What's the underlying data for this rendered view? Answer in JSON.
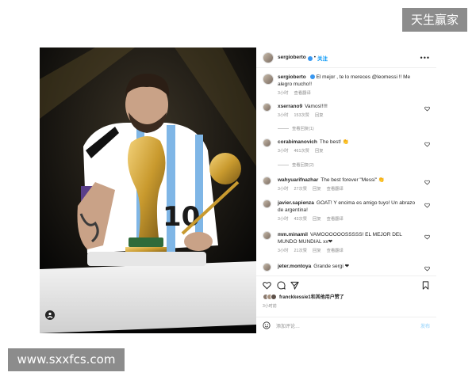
{
  "watermarks": {
    "top": "天生赢家",
    "bottom": "www.sxxfcs.com"
  },
  "photo": {
    "jersey_number": "10",
    "badge_icon": "info-icon"
  },
  "header": {
    "username": "sergioberto",
    "separator": "•",
    "follow_label": "关注",
    "more_icon": "more-horizontal-icon"
  },
  "caption": {
    "user": "sergioberto",
    "text": "El mejor , te lo mereces @leomessi !! Me alegro mucho!!",
    "time": "3小时",
    "translate": "查看翻译"
  },
  "comments": [
    {
      "user": "xserrano9",
      "text": "Vamos!!!!!",
      "time": "3小时",
      "likes": "153次赞",
      "reply": "回复",
      "replies": "查看回复(1)"
    },
    {
      "user": "corabimanovich",
      "text": "The best! 👏",
      "time": "3小时",
      "likes": "461次赞",
      "reply": "回复",
      "replies": "查看回复(2)"
    },
    {
      "user": "wahyuarifnazhar",
      "text": "The best forever \"Messi\" 👏",
      "time": "3小时",
      "likes": "27次赞",
      "reply": "回复",
      "translate": "查看翻译"
    },
    {
      "user": "javier.sapienza",
      "text": "GOAT! Y encima es amigo tuyo! Un abrazo de argentina!",
      "time": "3小时",
      "likes": "43次赞",
      "reply": "回复",
      "translate": "查看翻译"
    },
    {
      "user": "mm.minamil",
      "text": "VAMOOOOOOSSSSS! EL MEJOR DEL MUNDO MUNDIAL xx❤",
      "time": "3小时",
      "likes": "21次赞",
      "reply": "回复",
      "translate": "查看翻译"
    },
    {
      "user": "jeter.montoya",
      "text": "Grande sergi ❤"
    }
  ],
  "actions": {
    "like_icon": "heart-icon",
    "comment_icon": "comment-icon",
    "share_icon": "send-icon",
    "save_icon": "bookmark-icon"
  },
  "likes": {
    "text": "franckkessie1和其他用户赞了"
  },
  "post_date": "3小时前",
  "add_comment": {
    "emoji_icon": "smiley-icon",
    "placeholder": "添加评论…",
    "post_label": "发布"
  },
  "colors": {
    "link_blue": "#0095f6",
    "text": "#262626",
    "muted": "#8e8e8e",
    "gold": "#c99a2e",
    "jersey_blue": "#7fb6e6"
  }
}
